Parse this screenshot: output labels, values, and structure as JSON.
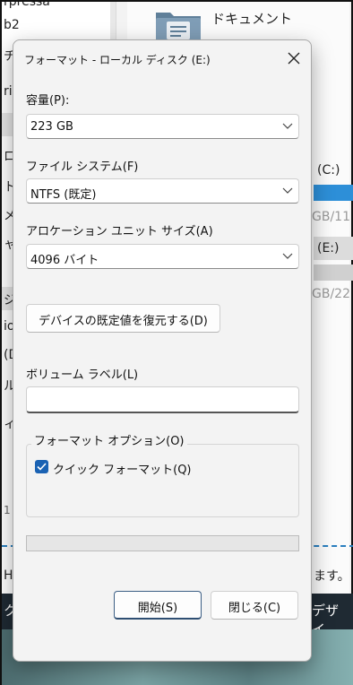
{
  "background": {
    "left_fragments": [
      "rpressa",
      "b2",
      "チ",
      "riv",
      "ロ",
      "ト",
      "メ",
      "ャ",
      "ジ",
      "io",
      "(D",
      "ル",
      "ィ",
      "1"
    ],
    "documents_label": "ドキュメント",
    "drive_c_label": "(C:)",
    "drive_c_size": "GB/11",
    "drive_e_label": "(E:)",
    "drive_e_size": "GB/22",
    "status_left": "HD",
    "status_right": "ます。",
    "dark_left": "ク",
    "dark_right": "デザイ"
  },
  "dialog": {
    "title": "フォーマット - ローカル ディスク (E:)",
    "capacity_label": "容量(P):",
    "capacity_value": "223 GB",
    "filesystem_label": "ファイル システム(F)",
    "filesystem_value": "NTFS (既定)",
    "allocation_label": "アロケーション ユニット サイズ(A)",
    "allocation_value": "4096 バイト",
    "restore_defaults": "デバイスの既定値を復元する(D)",
    "volume_label": "ボリューム ラベル(L)",
    "volume_value": "",
    "options_title": "フォーマット オプション(O)",
    "quick_format_label": "クイック フォーマット(Q)",
    "quick_format_checked": true,
    "progress": 0,
    "start_button": "開始(S)",
    "close_button": "閉じる(C)"
  }
}
